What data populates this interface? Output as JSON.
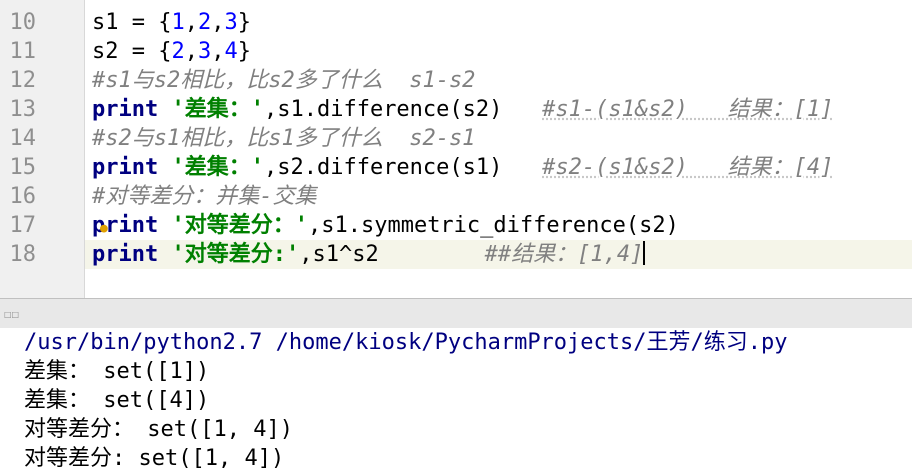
{
  "editor": {
    "lines": [
      {
        "no": "10",
        "parts": [
          [
            "plain",
            "s1 = {"
          ],
          [
            "num",
            "1"
          ],
          [
            "plain",
            ","
          ],
          [
            "num",
            "2"
          ],
          [
            "plain",
            ","
          ],
          [
            "num",
            "3"
          ],
          [
            "plain",
            "}"
          ]
        ]
      },
      {
        "no": "11",
        "parts": [
          [
            "plain",
            "s2 = {"
          ],
          [
            "num",
            "2"
          ],
          [
            "plain",
            ","
          ],
          [
            "num",
            "3"
          ],
          [
            "plain",
            ","
          ],
          [
            "num",
            "4"
          ],
          [
            "plain",
            "}"
          ]
        ]
      },
      {
        "no": "12",
        "parts": [
          [
            "cm",
            "#s1与s2相比，比s2多了什么  s1-s2"
          ]
        ]
      },
      {
        "no": "13",
        "parts": [
          [
            "kw",
            "print "
          ],
          [
            "str",
            "'差集：'"
          ],
          [
            "plain",
            ",s1.difference(s2)   "
          ],
          [
            "cm cm-u",
            "#s1-(s1&s2)   结果：[1]"
          ]
        ]
      },
      {
        "no": "14",
        "parts": [
          [
            "cm",
            "#s2与s1相比，比s1多了什么  s2-s1"
          ]
        ]
      },
      {
        "no": "15",
        "parts": [
          [
            "kw",
            "print "
          ],
          [
            "str",
            "'差集：'"
          ],
          [
            "plain",
            ",s2.difference(s1)   "
          ],
          [
            "cm cm-u",
            "#s2-(s1&s2)   结果：[4]"
          ]
        ]
      },
      {
        "no": "16",
        "parts": [
          [
            "cm",
            "#对等差分：并集-交集"
          ]
        ]
      },
      {
        "no": "17",
        "parts": [
          [
            "kw",
            "print "
          ],
          [
            "str",
            "'对等差分：'"
          ],
          [
            "plain",
            ",s1.symmetric_difference(s2)"
          ]
        ]
      },
      {
        "no": "18",
        "parts": [
          [
            "kw",
            "print "
          ],
          [
            "str",
            "'对等差分:'"
          ],
          [
            "plain",
            ",s1^s2        "
          ],
          [
            "cm",
            "##结果：[1,4]"
          ]
        ],
        "current": true
      }
    ]
  },
  "console": {
    "command": "/usr/bin/python2.7 /home/kiosk/PycharmProjects/王芳/练习.py",
    "output": [
      "差集： set([1])",
      "差集： set([4])",
      "对等差分： set([1, 4])",
      "对等差分: set([1, 4])"
    ]
  },
  "icons": {
    "bulb": "lightbulb-icon",
    "grip": "panel-grip-icon"
  }
}
